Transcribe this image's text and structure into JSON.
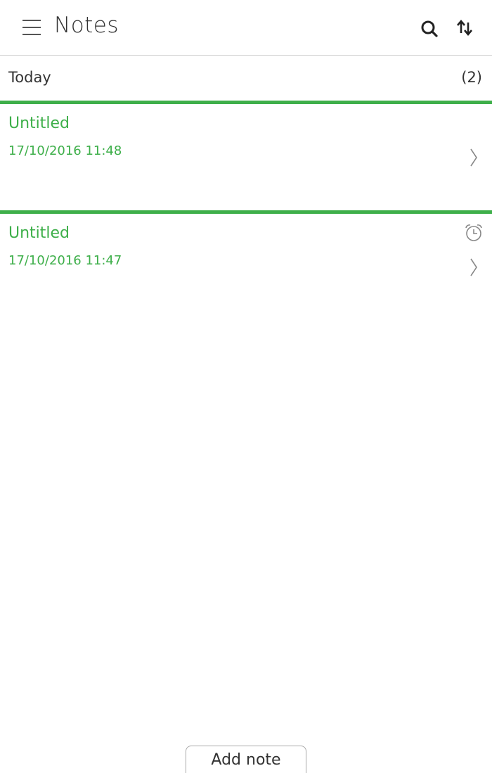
{
  "header": {
    "title": "Notes",
    "icons": {
      "menu": "hamburger-menu-icon",
      "search": "search-icon",
      "sort": "sort-icon"
    }
  },
  "section": {
    "label": "Today",
    "count": "(2)"
  },
  "notes": [
    {
      "title": "Untitled",
      "date": "17/10/2016 11:48",
      "has_reminder": false
    },
    {
      "title": "Untitled",
      "date": "17/10/2016 11:47",
      "has_reminder": true
    }
  ],
  "footer": {
    "add_label": "Add note"
  },
  "colors": {
    "accent": "#3eaf4a",
    "text": "#333333",
    "divider": "#cdcdcd"
  }
}
